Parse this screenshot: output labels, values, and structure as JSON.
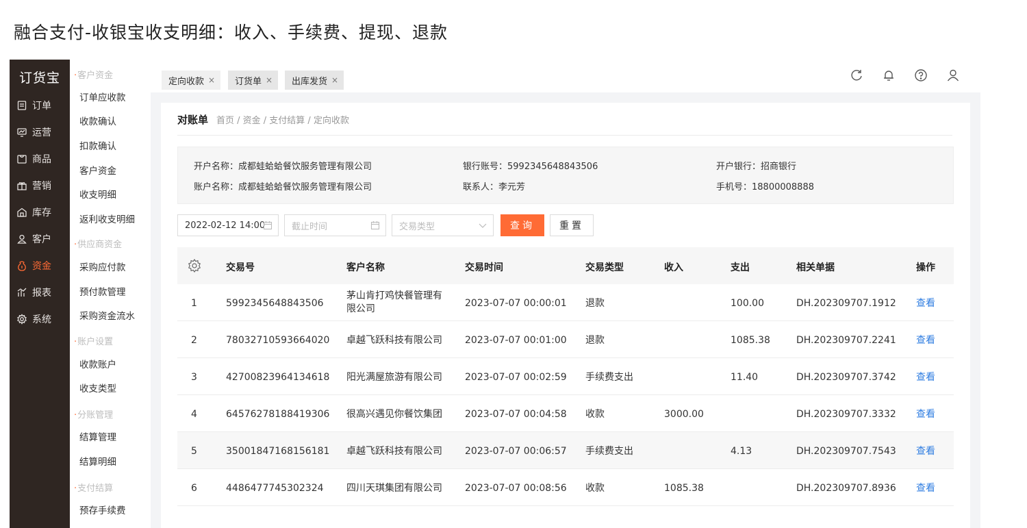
{
  "page_title": "融合支付-收银宝收支明细：收入、手续费、提现、退款",
  "app": {
    "logo": "订货宝",
    "rail": [
      {
        "label": "订单",
        "icon": "order-icon"
      },
      {
        "label": "运营",
        "icon": "operation-icon"
      },
      {
        "label": "商品",
        "icon": "product-icon"
      },
      {
        "label": "营销",
        "icon": "gift-icon"
      },
      {
        "label": "库存",
        "icon": "warehouse-icon"
      },
      {
        "label": "客户",
        "icon": "customer-icon"
      },
      {
        "label": "资金",
        "icon": "money-icon",
        "active": true
      },
      {
        "label": "报表",
        "icon": "report-icon"
      },
      {
        "label": "系统",
        "icon": "gear-icon"
      }
    ],
    "submenu": {
      "group1": "客户资金",
      "item1": "订单应收款",
      "item2": "收款确认",
      "item3": "扣款确认",
      "item4": "客户资金",
      "item5": "收支明细",
      "item6": "返利收支明细",
      "group2": "供应商资金",
      "item7": "采购应付款",
      "item8": "预付款管理",
      "item9": "采购资金流水",
      "group3": "账户设置",
      "item10": "收款账户",
      "item11": "收支类型",
      "group4": "分账管理",
      "item12": "结算管理",
      "item13": "结算明细",
      "group5": "支付结算",
      "item14": "预存手续费"
    },
    "tabs": [
      {
        "label": "定向收款"
      },
      {
        "label": "订货单"
      },
      {
        "label": "出库发货"
      }
    ],
    "tab_close": "×"
  },
  "crumbs": {
    "title": "对账单",
    "path": "首页 / 资金 / 支付结算 / 定向收款"
  },
  "info": {
    "account_open_name_label": "开户名称：",
    "account_open_name": "成都蛙蛤蛤餐饮服务管理有限公司",
    "bank_no_label": "银行账号：",
    "bank_no": "5992345648843506",
    "bank_label": "开户银行：",
    "bank": "招商银行",
    "account_name_label": "账户名称：",
    "account_name": "成都蛙蛤蛤餐饮服务管理有限公司",
    "contact_label": "联系人：",
    "contact": "李元芳",
    "phone_label": "手机号：",
    "phone": "18800008888"
  },
  "filters": {
    "start_date": "2022-02-12 14:00",
    "end_date_placeholder": "截止时间",
    "type_placeholder": "交易类型",
    "query_button": "查询",
    "reset_button": "重置"
  },
  "table": {
    "headers": {
      "seq": "",
      "trade_no": "交易号",
      "customer": "客户名称",
      "time": "交易时间",
      "type": "交易类型",
      "income": "收入",
      "expense": "支出",
      "doc": "相关单据",
      "action": "操作"
    },
    "rows": [
      {
        "seq": "1",
        "trade_no": "5992345648843506",
        "customer": "茅山肯打鸡快餐管理有限公司",
        "time": "2023-07-07 00:00:01",
        "type": "退款",
        "income": "",
        "expense": "100.00",
        "doc": "DH.202309707.1912",
        "action": "查看"
      },
      {
        "seq": "2",
        "trade_no": "78032710593664020",
        "customer": "卓越飞跃科技有限公司",
        "time": "2023-07-07 00:01:00",
        "type": "退款",
        "income": "",
        "expense": "1085.38",
        "doc": "DH.202309707.2241",
        "action": "查看"
      },
      {
        "seq": "3",
        "trade_no": "42700823964134618",
        "customer": "阳光满屋旅游有限公司",
        "time": "2023-07-07 00:02:59",
        "type": "手续费支出",
        "income": "",
        "expense": "11.40",
        "doc": "DH.202309707.3742",
        "action": "查看"
      },
      {
        "seq": "4",
        "trade_no": "64576278188419306",
        "customer": "很高兴遇见你餐饮集团",
        "time": "2023-07-07 00:04:58",
        "type": "收款",
        "income": "3000.00",
        "expense": "",
        "doc": "DH.202309707.3332",
        "action": "查看"
      },
      {
        "seq": "5",
        "trade_no": "35001847168156181",
        "customer": "卓越飞跃科技有限公司",
        "time": "2023-07-07 00:06:57",
        "type": "手续费支出",
        "income": "",
        "expense": "4.13",
        "doc": "DH.202309707.7543",
        "action": "查看"
      },
      {
        "seq": "6",
        "trade_no": "4486477745302324",
        "customer": "四川天琪集团有限公司",
        "time": "2023-07-07 00:08:56",
        "type": "收款",
        "income": "1085.38",
        "expense": "",
        "doc": "DH.202309707.8936",
        "action": "查看"
      }
    ]
  }
}
